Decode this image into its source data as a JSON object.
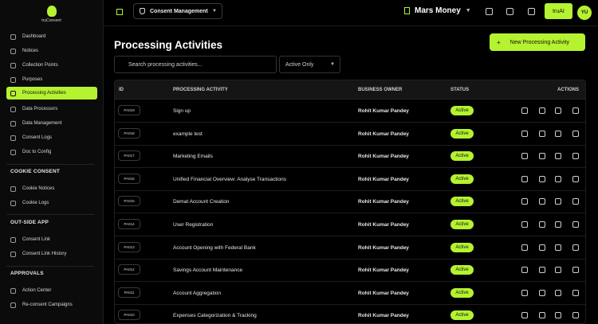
{
  "brand": {
    "name": "truConsent"
  },
  "sidebar": {
    "items": [
      {
        "label": "Dashboard",
        "icon": "dashboard-icon"
      },
      {
        "label": "Notices",
        "icon": "notice-icon"
      },
      {
        "label": "Collection Points",
        "icon": "collection-icon"
      },
      {
        "label": "Purposes",
        "icon": "purpose-icon"
      },
      {
        "label": "Processing Activities",
        "icon": "activity-icon",
        "active": true
      },
      {
        "label": "Data Processors",
        "icon": "processor-icon"
      },
      {
        "label": "Data Management",
        "icon": "data-icon"
      },
      {
        "label": "Consent Logs",
        "icon": "logs-icon"
      },
      {
        "label": "Doc to Config",
        "icon": "doc-icon"
      }
    ],
    "sections": [
      {
        "title": "COOKIE CONSENT",
        "items": [
          {
            "label": "Cookie Notices"
          },
          {
            "label": "Cookie Logs"
          }
        ]
      },
      {
        "title": "OUT-SIDE APP",
        "items": [
          {
            "label": "Consent Link"
          },
          {
            "label": "Consent Link History"
          }
        ]
      },
      {
        "title": "APPROVALS",
        "items": [
          {
            "label": "Action Center"
          },
          {
            "label": "Re-consent Campaigns"
          }
        ]
      }
    ]
  },
  "topbar": {
    "workspace": "Consent Management",
    "org": "Mars Money",
    "truai_label": "truAI",
    "avatar": "YU"
  },
  "page": {
    "title": "Processing Activities",
    "new_button": "New Processing Activity",
    "search_placeholder": "Search processing activities...",
    "filter": "Active Only"
  },
  "table": {
    "columns": {
      "id": "ID",
      "activity": "PROCESSING ACTIVITY",
      "owner": "BUSINESS OWNER",
      "status": "STATUS",
      "actions": "ACTIONS"
    },
    "rows": [
      {
        "id": "PA019",
        "activity": "Sign up",
        "owner": "Rohit Kumar Pandey",
        "status": "Active"
      },
      {
        "id": "PA018",
        "activity": "example test",
        "owner": "Rohit Kumar Pandey",
        "status": "Active"
      },
      {
        "id": "PA017",
        "activity": "Marketing Emails",
        "owner": "Rohit Kumar Pandey",
        "status": "Active"
      },
      {
        "id": "PA016",
        "activity": "Unified Financial Overview: Analyse Transactions",
        "owner": "Rohit Kumar Pandey",
        "status": "Active"
      },
      {
        "id": "PA015",
        "activity": "Demat Account Creation",
        "owner": "Rohit Kumar Pandey",
        "status": "Active"
      },
      {
        "id": "PA014",
        "activity": "User Registration",
        "owner": "Rohit Kumar Pandey",
        "status": "Active"
      },
      {
        "id": "PA013",
        "activity": "Account Opening with Federal Bank",
        "owner": "Rohit Kumar Pandey",
        "status": "Active"
      },
      {
        "id": "PA012",
        "activity": "Savings Account Maintenance",
        "owner": "Rohit Kumar Pandey",
        "status": "Active"
      },
      {
        "id": "PA011",
        "activity": "Account Aggregation",
        "owner": "Rohit Kumar Pandey",
        "status": "Active"
      },
      {
        "id": "PA010",
        "activity": "Expenses Categorization & Tracking",
        "owner": "Rohit Kumar Pandey",
        "status": "Active"
      }
    ]
  },
  "colors": {
    "accent": "#b5f230",
    "background": "#000000"
  }
}
